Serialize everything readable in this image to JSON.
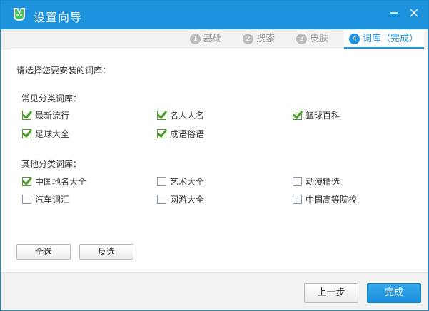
{
  "window": {
    "title": "设置向导"
  },
  "tabs": [
    {
      "num": "1",
      "label": "基础"
    },
    {
      "num": "2",
      "label": "搜索"
    },
    {
      "num": "3",
      "label": "皮肤"
    },
    {
      "num": "4",
      "label": "词库（完成）"
    }
  ],
  "prompt": "请选择您要安装的词库：",
  "common": {
    "title": "常见分类词库：",
    "items": [
      {
        "label": "最新流行",
        "checked": true
      },
      {
        "label": "名人人名",
        "checked": true
      },
      {
        "label": "篮球百科",
        "checked": true
      },
      {
        "label": "足球大全",
        "checked": true
      },
      {
        "label": "成语俗语",
        "checked": true
      }
    ]
  },
  "other": {
    "title": "其他分类词库：",
    "items": [
      {
        "label": "中国地名大全",
        "checked": true
      },
      {
        "label": "艺术大全",
        "checked": false
      },
      {
        "label": "动漫精选",
        "checked": false
      },
      {
        "label": "汽车词汇",
        "checked": false
      },
      {
        "label": "网游大全",
        "checked": false
      },
      {
        "label": "中国高等院校",
        "checked": false
      }
    ]
  },
  "buttons": {
    "select_all": "全选",
    "invert": "反选",
    "prev": "上一步",
    "finish": "完成"
  },
  "colors": {
    "accent": "#1d93de",
    "check": "#4a9b2c"
  }
}
